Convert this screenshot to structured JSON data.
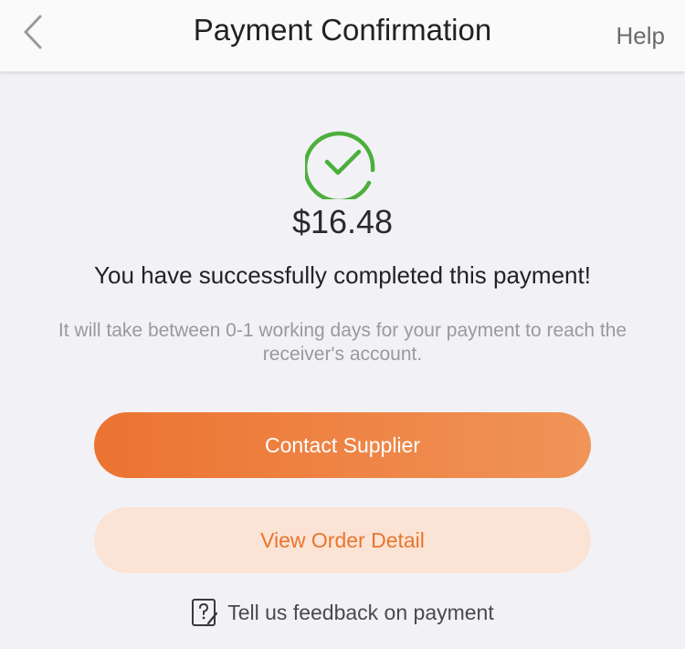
{
  "header": {
    "title": "Payment Confirmation",
    "help_label": "Help",
    "back_icon": "chevron-left-icon"
  },
  "status": {
    "icon": "check-circle-icon",
    "color": "#4caf3d"
  },
  "payment": {
    "amount": "$16.48",
    "success_message": "You have successfully completed this payment!",
    "note": "It will take between 0-1 working days for your payment to reach the receiver's account."
  },
  "actions": {
    "contact_supplier_label": "Contact Supplier",
    "view_order_label": "View Order Detail"
  },
  "feedback": {
    "label": "Tell us feedback on payment",
    "icon": "feedback-icon"
  },
  "colors": {
    "accent": "#ec7331",
    "accent_light": "#fbe3d5",
    "success": "#4caf3d"
  }
}
